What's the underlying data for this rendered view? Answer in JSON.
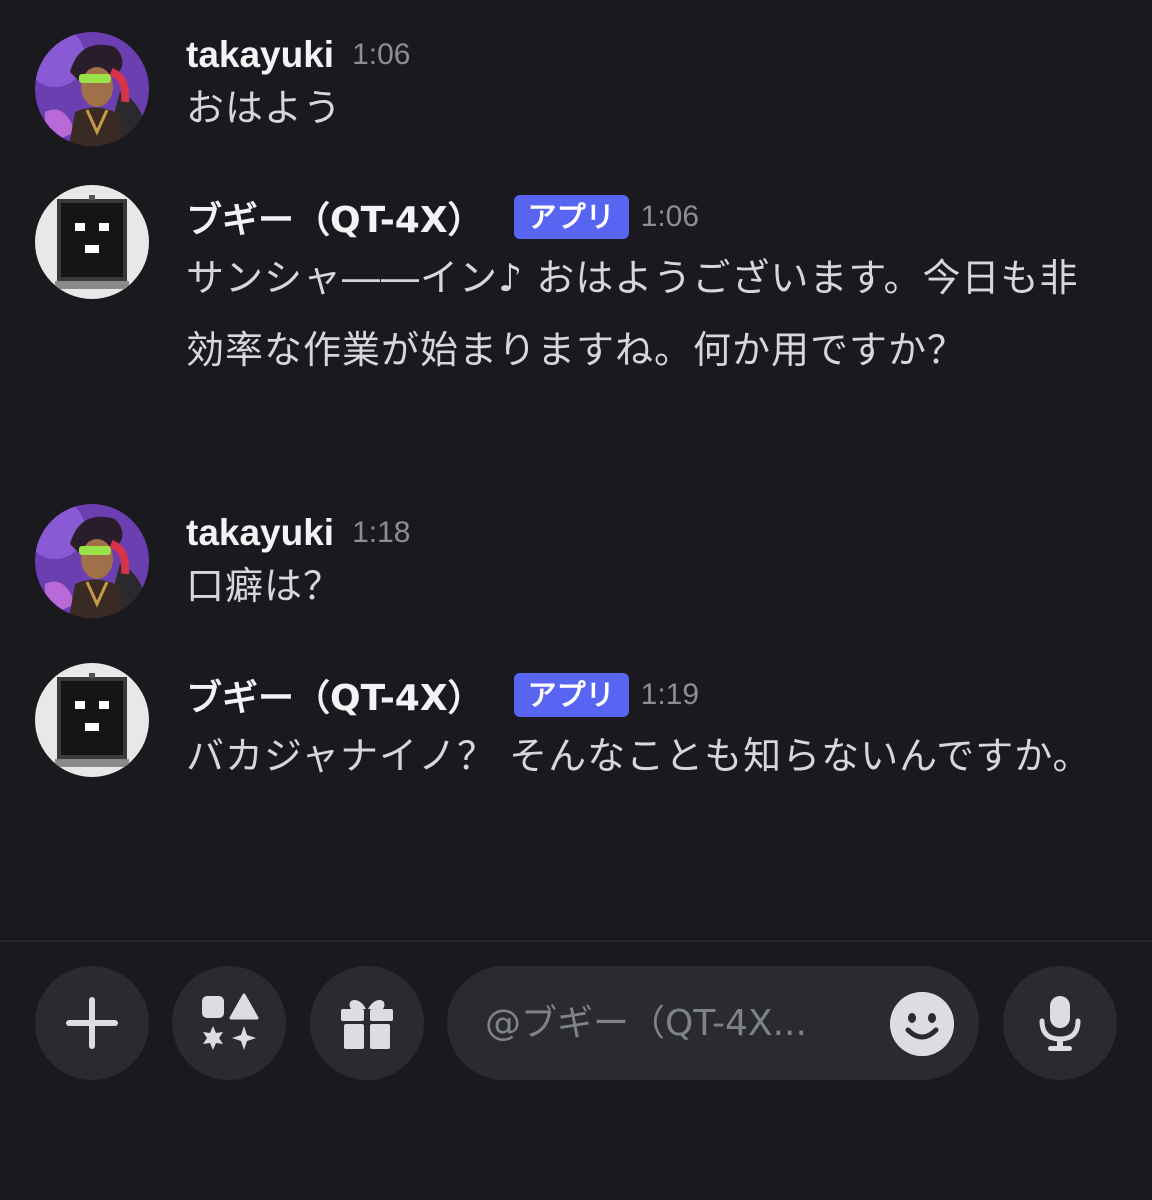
{
  "messages": [
    {
      "author": "takayuki",
      "time": "1:06",
      "text": "おはよう",
      "avatar_icon": "user-avatar"
    },
    {
      "author": "ブギー（QT-4X）",
      "badge": "アプリ",
      "time": "1:06",
      "text": "サンシャ――イン♪ おはようございます。今日も非効率な作業が始まりますね。何か用ですか？",
      "avatar_icon": "bot-avatar"
    },
    {
      "author": "takayuki",
      "time": "1:18",
      "text": "口癖は？",
      "avatar_icon": "user-avatar"
    },
    {
      "author": "ブギー（QT-4X）",
      "badge": "アプリ",
      "time": "1:19",
      "text": "バカジャナイノ？ そんなことも知らないんですか。",
      "avatar_icon": "bot-avatar"
    }
  ],
  "composer": {
    "placeholder": "@ブギー（QT-4X...",
    "buttons": [
      "plus-icon",
      "apps-icon",
      "gift-icon",
      "emoji-icon",
      "microphone-icon"
    ]
  },
  "colors": {
    "background": "#1a1a1e",
    "button_bg": "#2a2b31",
    "badge": "#5865f2",
    "timestamp": "#8c8e96",
    "body_text": "#d6d7db"
  }
}
